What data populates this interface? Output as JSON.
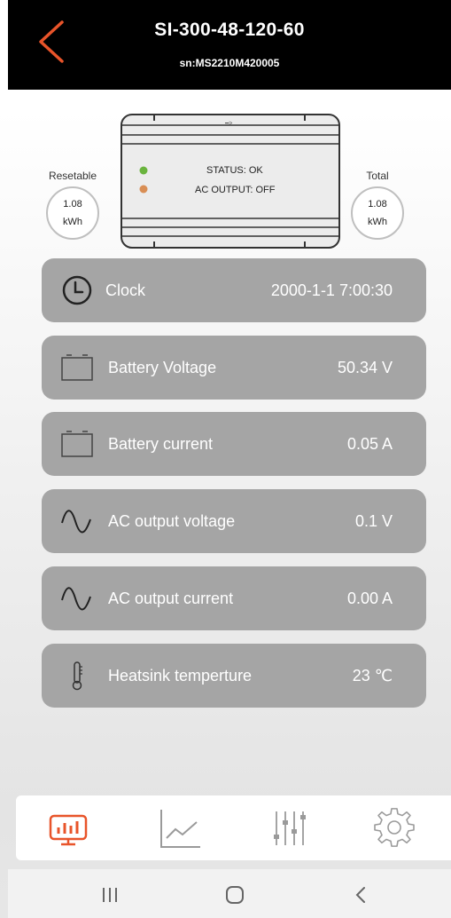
{
  "header": {
    "title": "SI-300-48-120-60",
    "serial": "sn:MS2210M420005"
  },
  "device": {
    "status_text": "STATUS: OK",
    "ac_output_text": "AC OUTPUT: OFF",
    "status_led_color": "#6ab43e",
    "ac_led_color": "#d98e55"
  },
  "energy": {
    "resetable": {
      "label": "Resetable",
      "value": "1.08",
      "unit": "kWh"
    },
    "total": {
      "label": "Total",
      "value": "1.08",
      "unit": "kWh"
    }
  },
  "rows": [
    {
      "icon": "clock-icon",
      "label": "Clock",
      "value": "2000-1-1 7:00:30"
    },
    {
      "icon": "battery-icon",
      "label": "Battery Voltage",
      "value": "50.34 V"
    },
    {
      "icon": "battery-icon",
      "label": "Battery current",
      "value": "0.05 A"
    },
    {
      "icon": "sine-wave-icon",
      "label": "AC output voltage",
      "value": "0.1 V"
    },
    {
      "icon": "sine-wave-icon",
      "label": "AC output current",
      "value": "0.00 A"
    },
    {
      "icon": "thermometer-icon",
      "label": "Heatsink temperture",
      "value": "23 ℃"
    }
  ],
  "bottom_nav": {
    "active_color": "#e8542a",
    "inactive_color": "#9a9a9a",
    "items": [
      "dashboard-icon",
      "chart-line-icon",
      "sliders-icon",
      "settings-gear-icon"
    ]
  },
  "colors": {
    "header_bg": "#000000",
    "accent": "#e8542a",
    "row_bg": "#a5a5a5"
  }
}
